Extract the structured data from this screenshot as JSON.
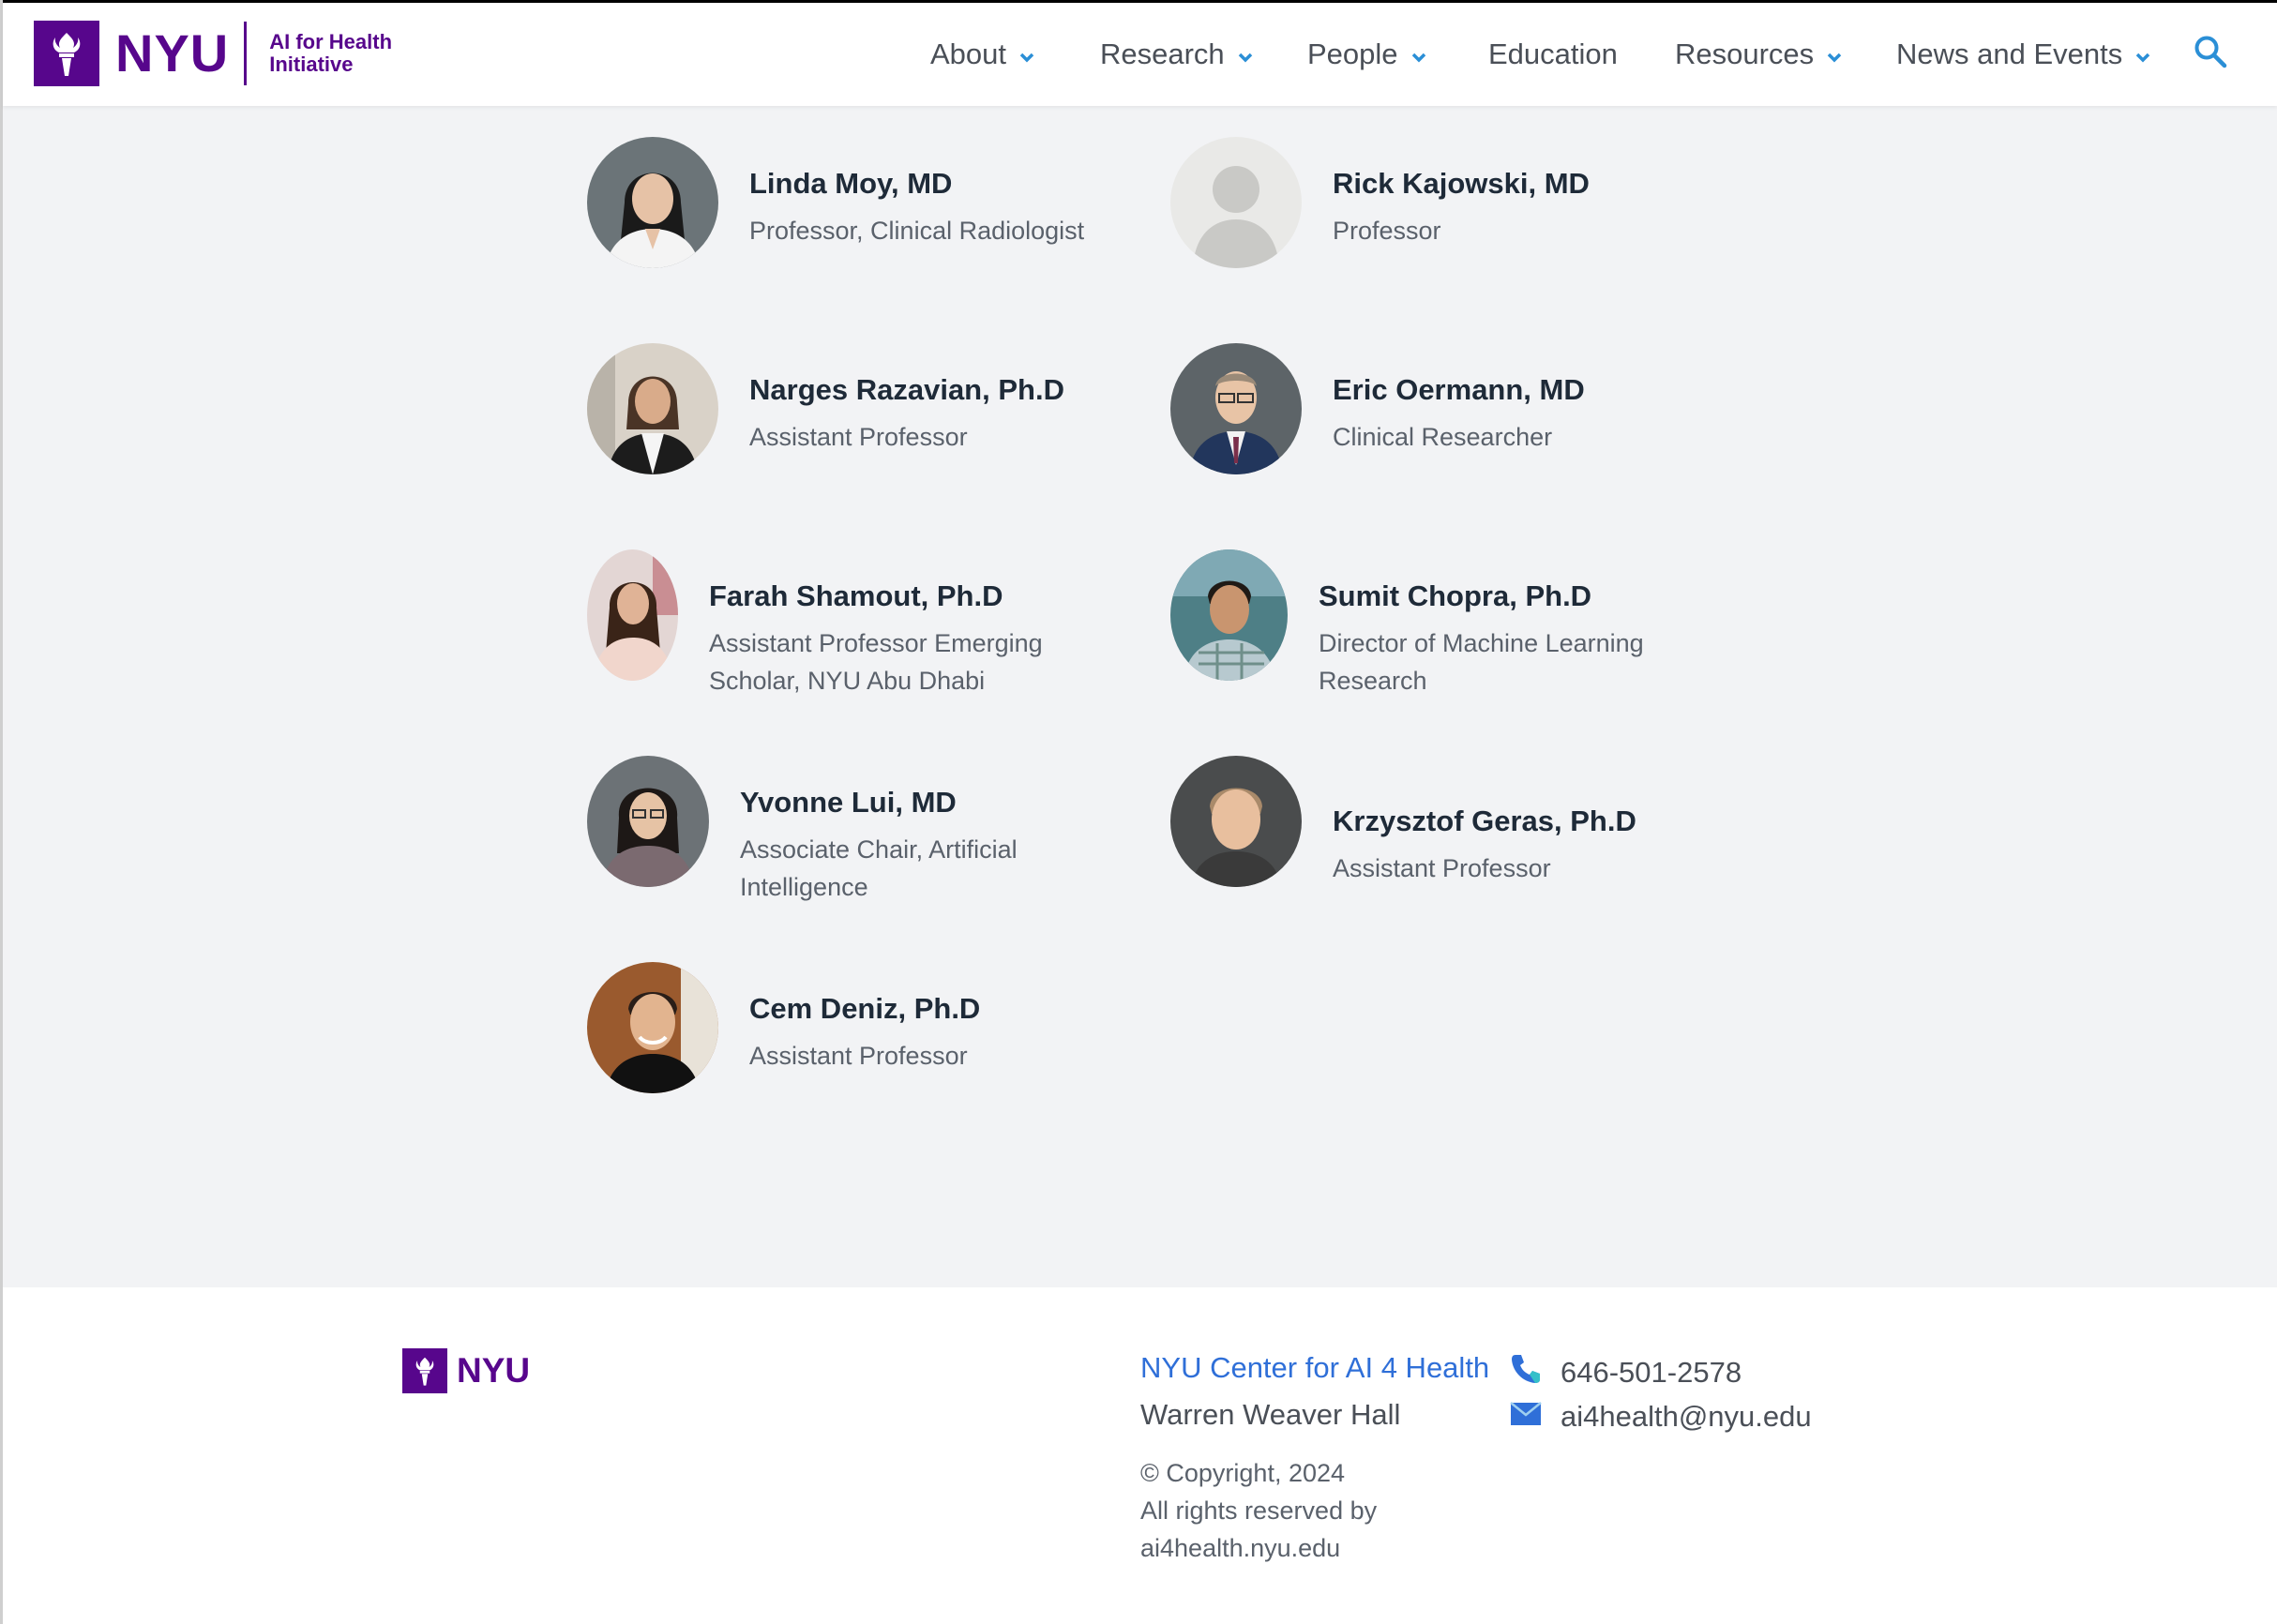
{
  "header": {
    "logo_text": "NYU",
    "logo_subtitle_line1": "AI for Health",
    "logo_subtitle_line2": "Initiative",
    "nav": [
      {
        "label": "About",
        "has_dropdown": true
      },
      {
        "label": "Research",
        "has_dropdown": true
      },
      {
        "label": "People",
        "has_dropdown": true
      },
      {
        "label": "Education",
        "has_dropdown": false
      },
      {
        "label": "Resources",
        "has_dropdown": true
      },
      {
        "label": "News and Events",
        "has_dropdown": true
      }
    ],
    "search_icon": "search-icon"
  },
  "people": [
    {
      "name": "Linda Moy, MD",
      "role_line1": "Professor, Clinical Radiologist",
      "role_line2": ""
    },
    {
      "name": "Rick Kajowski, MD",
      "role_line1": "Professor",
      "role_line2": ""
    },
    {
      "name": "Narges Razavian, Ph.D",
      "role_line1": "Assistant Professor",
      "role_line2": ""
    },
    {
      "name": "Eric Oermann, MD",
      "role_line1": "Clinical Researcher",
      "role_line2": ""
    },
    {
      "name": "Farah Shamout, Ph.D",
      "role_line1": "Assistant Professor Emerging",
      "role_line2": "Scholar, NYU Abu Dhabi"
    },
    {
      "name": "Sumit Chopra, Ph.D",
      "role_line1": "Director of Machine Learning",
      "role_line2": "Research"
    },
    {
      "name": "Yvonne Lui, MD",
      "role_line1": "Associate Chair, Artificial",
      "role_line2": "Intelligence"
    },
    {
      "name": "Krzysztof Geras, Ph.D",
      "role_line1": "Assistant Professor",
      "role_line2": ""
    },
    {
      "name": "Cem Deniz, Ph.D",
      "role_line1": "Assistant Professor",
      "role_line2": ""
    }
  ],
  "footer": {
    "logo_text": "NYU",
    "center_name": "NYU Center for AI 4 Health",
    "address": "Warren Weaver Hall",
    "copyright_line1": "© Copyright, 2024",
    "copyright_line2": "All rights reserved by",
    "copyright_line3": "ai4health.nyu.edu",
    "phone": "646-501-2578",
    "email": "ai4health@nyu.edu"
  },
  "colors": {
    "brand_purple": "#57068c",
    "accent_blue": "#2f6fd8",
    "page_bg": "#f2f3f5"
  }
}
